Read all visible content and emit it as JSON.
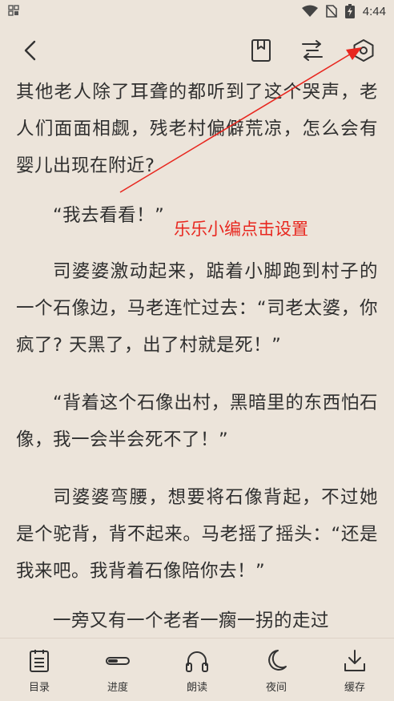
{
  "status_bar": {
    "time": "4:44"
  },
  "reader": {
    "paragraphs": [
      "其他老人除了耳聋的都听到了这个哭声，老人们面面相觑，残老村偏僻荒凉，怎么会有婴儿出现在附近?",
      "“我去看看！”",
      "司婆婆激动起来，踮着小脚跑到村子的一个石像边，马老连忙过去：“司老太婆，你疯了? 天黑了，出了村就是死！”",
      "“背着这个石像出村，黑暗里的东西怕石像，我一会半会死不了！”",
      "司婆婆弯腰，想要将石像背起，不过她是个驼背，背不起来。马老摇了摇头：“还是我来吧。我背着石像陪你去！”",
      "一旁又有一个老者一瘸一拐的走过"
    ]
  },
  "annotation": {
    "label": "乐乐小编点击设置",
    "color": "#e8271f"
  },
  "bottom_nav": {
    "items": [
      {
        "label": "目录",
        "icon": "catalog-icon"
      },
      {
        "label": "进度",
        "icon": "progress-icon"
      },
      {
        "label": "朗读",
        "icon": "headphones-icon"
      },
      {
        "label": "夜间",
        "icon": "moon-icon"
      },
      {
        "label": "缓存",
        "icon": "download-icon"
      }
    ]
  }
}
